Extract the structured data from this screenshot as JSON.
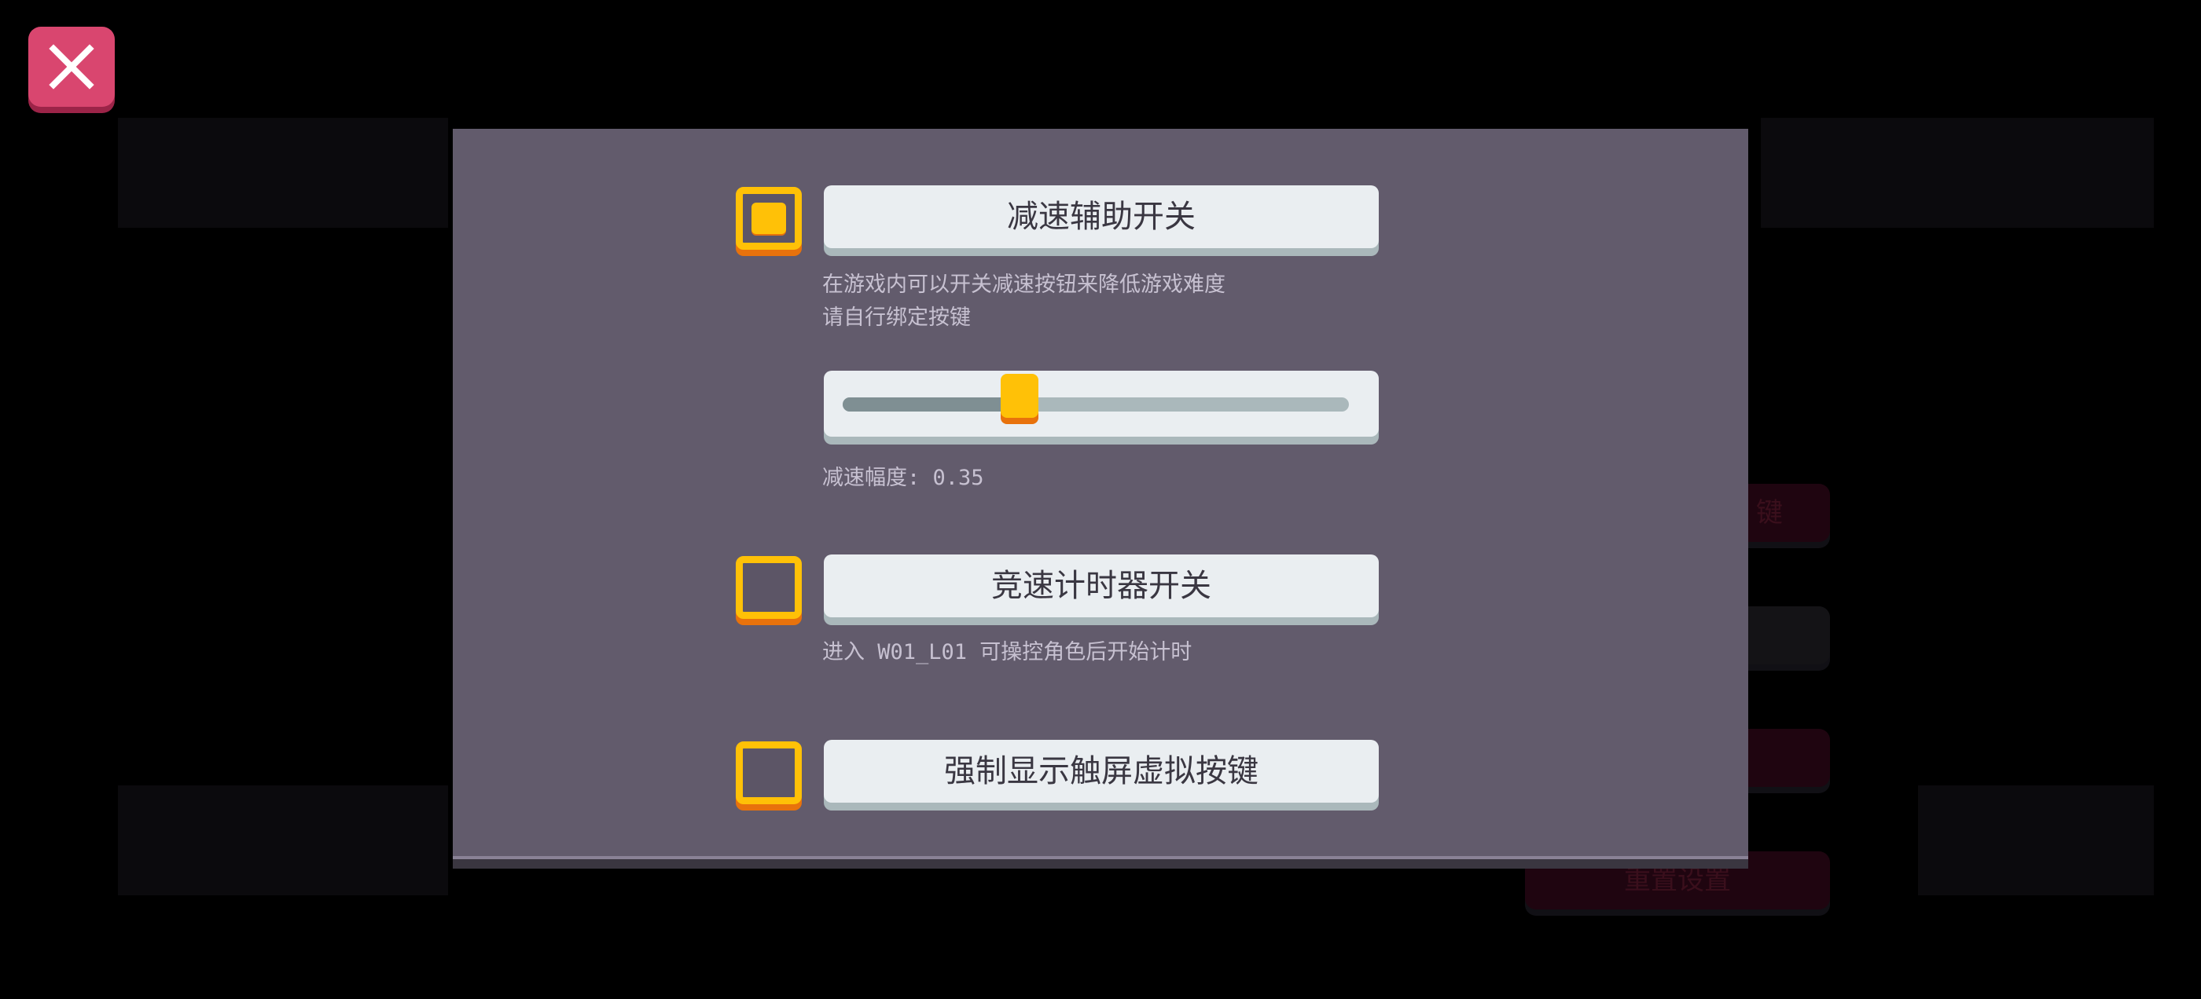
{
  "close_button": {
    "icon": "close-icon",
    "color": "#d9466f"
  },
  "background_menu": {
    "buttons": [
      {
        "label": "键",
        "style": "red"
      },
      {
        "label": "",
        "style": "dark"
      },
      {
        "label": "",
        "style": "red"
      },
      {
        "label": "重置设置",
        "style": "red"
      }
    ]
  },
  "settings": {
    "slowdown": {
      "enabled": true,
      "label": "减速辅助开关",
      "description": "在游戏内可以开关减速按钮来降低游戏难度\n请自行绑定按键",
      "slider_value": 0.35,
      "amount_text": "减速幅度: 0.35"
    },
    "speedrun_timer": {
      "enabled": false,
      "label": "竞速计时器开关",
      "description": "进入 W01_L01 可操控角色后开始计时"
    },
    "force_touch_buttons": {
      "enabled": false,
      "label": "强制显示触屏虚拟按键"
    }
  },
  "colors": {
    "modal_bg": "#625b6c",
    "accent_yellow": "#ffc107",
    "accent_orange": "#e8720c",
    "button_bg": "#eaeef1",
    "text_light": "#c7c1d1"
  }
}
